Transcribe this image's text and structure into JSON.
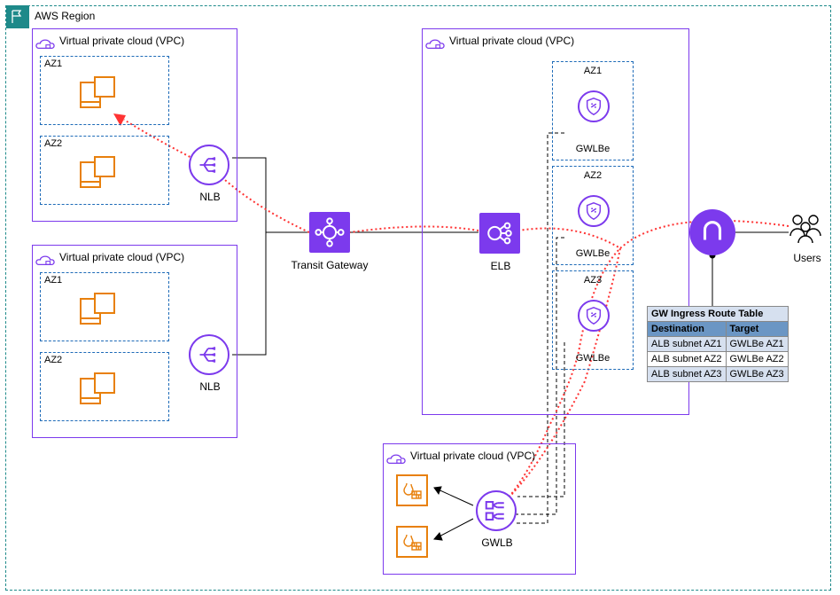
{
  "region_label": "AWS Region",
  "vpc": {
    "label": "Virtual private cloud (VPC)"
  },
  "az": {
    "az1": "AZ1",
    "az2": "AZ2",
    "az3": "AZ3"
  },
  "services": {
    "nlb": "NLB",
    "transit_gateway": "Transit Gateway",
    "elb": "ELB",
    "gwlbe": "GWLBe",
    "gwlb": "GWLB",
    "users": "Users"
  },
  "route_table": {
    "title": "GW Ingress Route Table",
    "columns": [
      "Destination",
      "Target"
    ],
    "rows": [
      [
        "ALB subnet AZ1",
        "GWLBe AZ1"
      ],
      [
        "ALB subnet AZ2",
        "GWLBe AZ2"
      ],
      [
        "ALB subnet AZ3",
        "GWLBe AZ3"
      ]
    ]
  }
}
